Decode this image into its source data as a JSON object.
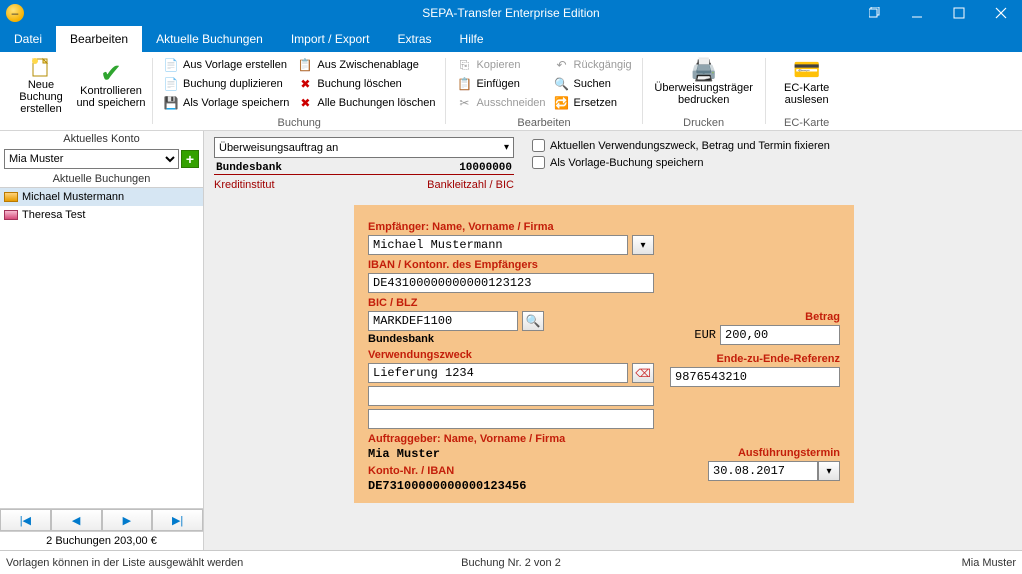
{
  "window": {
    "title": "SEPA-Transfer  Enterprise Edition"
  },
  "menus": [
    "Datei",
    "Bearbeiten",
    "Aktuelle Buchungen",
    "Import / Export",
    "Extras",
    "Hilfe"
  ],
  "active_menu_index": 1,
  "ribbon": {
    "neue_buchung": "Neue Buchung\nerstellen",
    "kontrollieren": "Kontrollieren\nund speichern",
    "group_buchung": "Buchung",
    "aus_vorlage": "Aus Vorlage erstellen",
    "duplizieren": "Buchung duplizieren",
    "als_vorlage": "Als Vorlage speichern",
    "zwischenablage": "Aus Zwischenablage",
    "loeschen": "Buchung löschen",
    "alle_loeschen": "Alle Buchungen löschen",
    "group_bearbeiten": "Bearbeiten",
    "kopieren": "Kopieren",
    "einfuegen": "Einfügen",
    "ausschneiden": "Ausschneiden",
    "rueckgaengig": "Rückgängig",
    "suchen": "Suchen",
    "ersetzen": "Ersetzen",
    "traeger": "Überweisungsträger\nbedrucken",
    "group_drucken": "Drucken",
    "eckarte": "EC-Karte\nauslesen",
    "group_eckarte": "EC-Karte"
  },
  "left": {
    "aktuelles_konto": "Aktuelles Konto",
    "konto_value": "Mia Muster",
    "aktuelle_buchungen": "Aktuelle Buchungen",
    "items": [
      {
        "name": "Michael Mustermann",
        "selected": true,
        "color": "#e69b00"
      },
      {
        "name": "Theresa Test",
        "selected": false,
        "color": "#d64a7b"
      }
    ],
    "nav": [
      "|◀",
      "◀",
      "▶",
      "▶|"
    ],
    "summary": "2 Buchungen 203,00 €"
  },
  "topform": {
    "auftrag_label": "Überweisungsauftrag an",
    "bank_name": "Bundesbank",
    "bank_blz": "10000000",
    "lbl_kreditinstitut": "Kreditinstitut",
    "lbl_blz": "Bankleitzahl / BIC",
    "chk_fix": "Aktuellen Verwendungszweck, Betrag und Termin fixieren",
    "chk_vorlage": "Als Vorlage-Buchung speichern"
  },
  "form": {
    "lbl_empfaenger": "Empfänger: Name, Vorname / Firma",
    "empfaenger": "Michael Mustermann",
    "lbl_iban": "IBAN / Kontonr. des Empfängers",
    "iban": "DE43100000000000123123",
    "lbl_bic": "BIC / BLZ",
    "bic": "MARKDEF1100",
    "bic_bank": "Bundesbank",
    "lbl_betrag": "Betrag",
    "currency": "EUR",
    "betrag": "200,00",
    "lbl_e2e": "Ende-zu-Ende-Referenz",
    "e2e": "9876543210",
    "lbl_zweck": "Verwendungszweck",
    "zweck1": "Lieferung 1234",
    "zweck2": "",
    "zweck3": "",
    "lbl_auftraggeber": "Auftraggeber: Name, Vorname / Firma",
    "auftraggeber": "Mia Muster",
    "lbl_kontonr": "Konto-Nr. / IBAN",
    "auftraggeber_iban": "DE73100000000000123456",
    "lbl_termin": "Ausführungstermin",
    "termin": "30.08.2017"
  },
  "status": {
    "left": "Vorlagen können in der Liste ausgewählt werden",
    "center": "Buchung Nr. 2 von 2",
    "right": "Mia Muster"
  }
}
